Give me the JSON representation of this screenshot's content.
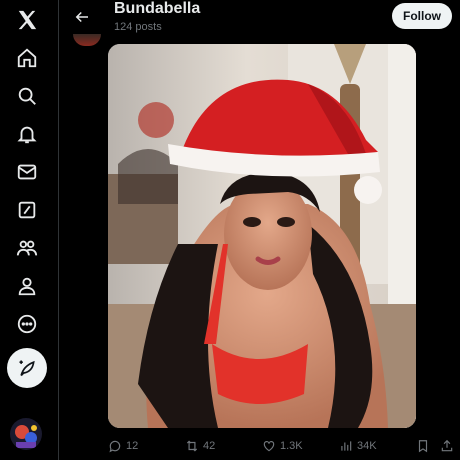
{
  "header": {
    "title": "Bundabella",
    "subtitle": "124 posts",
    "follow_label": "Follow"
  },
  "nav": {
    "items": [
      {
        "name": "x-logo-icon"
      },
      {
        "name": "home-icon"
      },
      {
        "name": "search-icon"
      },
      {
        "name": "notifications-icon"
      },
      {
        "name": "messages-icon"
      },
      {
        "name": "grok-icon"
      },
      {
        "name": "communities-icon"
      },
      {
        "name": "profile-icon"
      },
      {
        "name": "more-icon"
      },
      {
        "name": "compose-post-icon"
      }
    ]
  },
  "post": {
    "replies": "12",
    "reposts": "42",
    "likes": "1.3K",
    "views": "34K"
  },
  "colors": {
    "background": "#000000",
    "text": "#e7e9ea",
    "muted": "#71767b",
    "button": "#eff3f4"
  }
}
